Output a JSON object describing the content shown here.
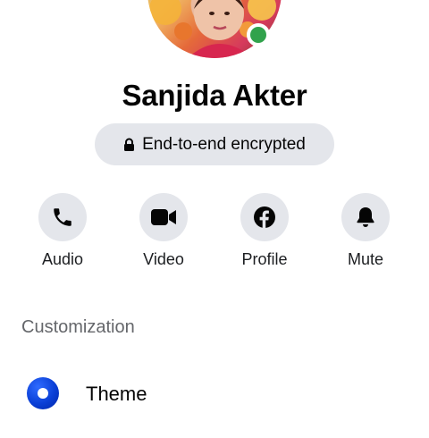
{
  "profile": {
    "name": "Sanjida Akter",
    "online": true
  },
  "encryption": {
    "label": "End-to-end encrypted",
    "icon": "lock-icon"
  },
  "actions": [
    {
      "label": "Audio",
      "icon": "phone-icon"
    },
    {
      "label": "Video",
      "icon": "video-camera-icon"
    },
    {
      "label": "Profile",
      "icon": "facebook-icon"
    },
    {
      "label": "Mute",
      "icon": "bell-icon"
    }
  ],
  "customization": {
    "title": "Customization",
    "theme": {
      "label": "Theme",
      "color": "#0a3fd6"
    }
  },
  "colors": {
    "button_bg": "#e4e6eb",
    "online": "#31a24c",
    "secondary_text": "#65676b"
  }
}
